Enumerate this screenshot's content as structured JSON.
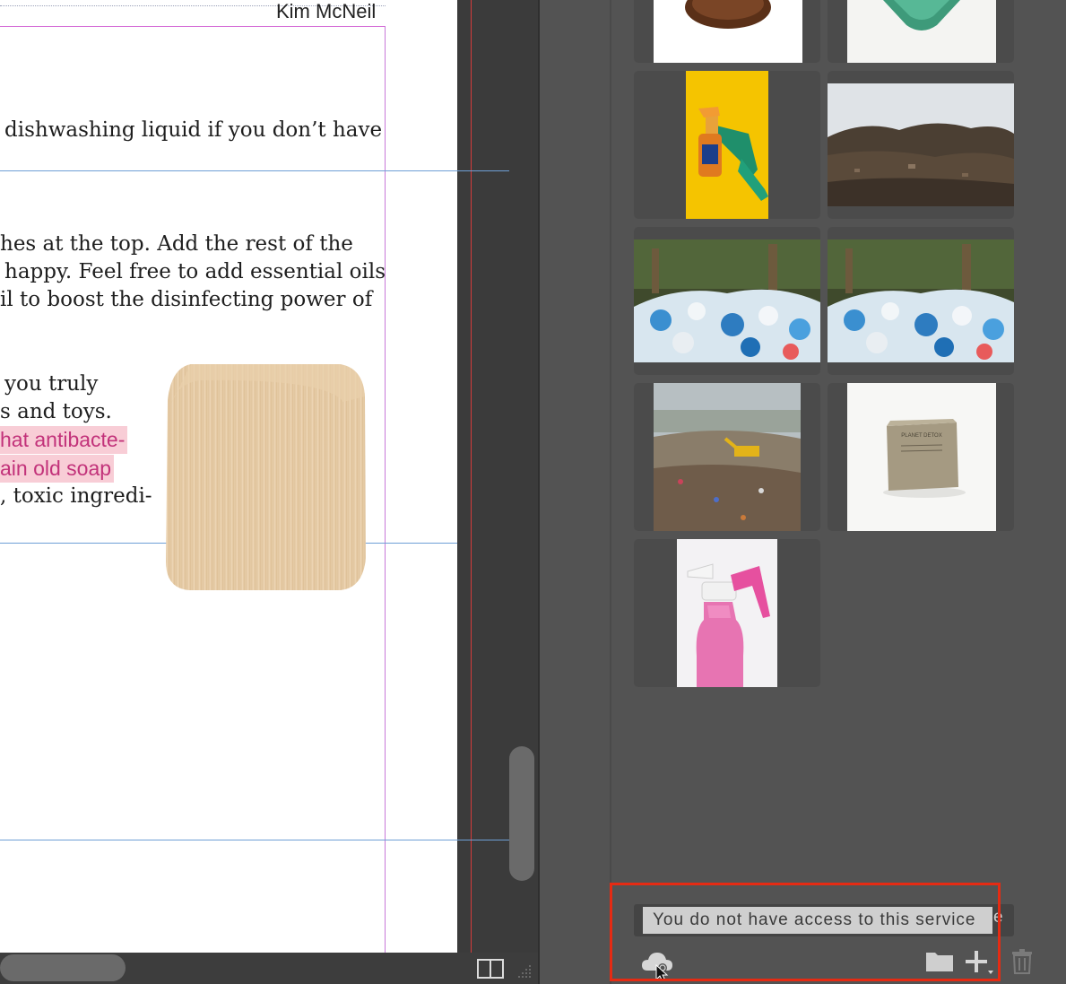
{
  "document": {
    "header_author": "Kim McNeil",
    "lines": [
      "dishwashing liquid if you don’t have",
      "hes at the top. Add the rest of the",
      "happy. Feel free to add essential oils",
      "il to boost the disinfecting power of",
      "you truly",
      "s and toys.",
      "hat antibacte-",
      "ain old soap",
      ", toxic ingredi-"
    ]
  },
  "panel": {
    "tooltip_text": "You do not have access to this service",
    "tooltip_overflow_char": "e",
    "thumbnails": [
      "wooden-brush-image",
      "green-sponge-image",
      "spray-bottle-yellow-image",
      "scrap-metal-pile-image",
      "plastic-bottles-image-1",
      "plastic-bottles-image-2",
      "landfill-excavator-image",
      "planet-detox-soap-bar-image",
      "pink-spray-bottle-image"
    ]
  },
  "colors": {
    "highlight_border": "#e52b13",
    "guide_blue": "#6e9fd6",
    "margin_magenta": "#c879d8",
    "pink_text": "#c2327a",
    "pink_highlight": "#f8cdd6"
  },
  "icons": [
    "cloud-sync-icon",
    "folder-icon",
    "add-icon",
    "trash-icon",
    "split-view-icon",
    "resize-grip-icon"
  ]
}
